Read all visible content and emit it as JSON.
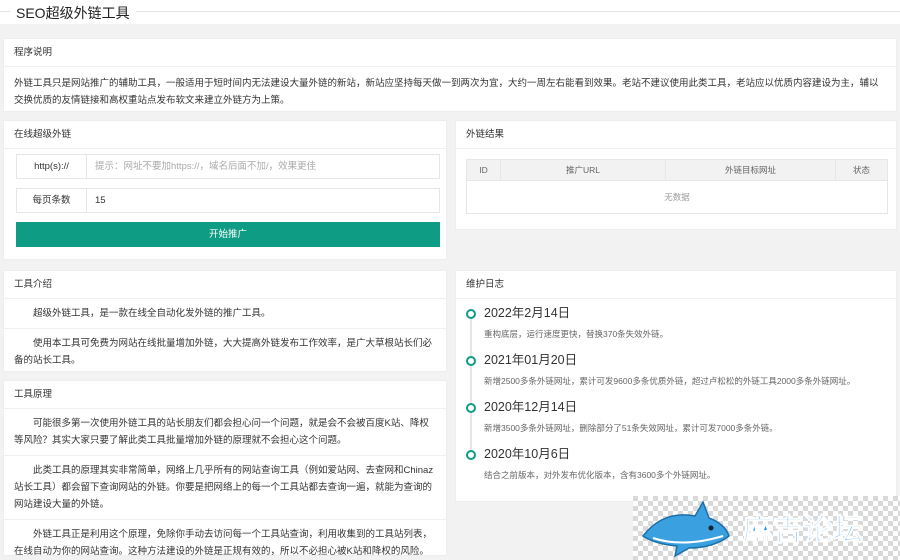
{
  "page": {
    "title": "SEO超级外链工具"
  },
  "intro": {
    "header": "程序说明",
    "text": "外链工具只是网站推广的辅助工具，一般适用于短时间内无法建设大量外链的新站，新站应坚持每天做一到两次为宜，大约一周左右能看到效果。老站不建议使用此类工具，老站应以优质内容建设为主，辅以交换优质的友情链接和高权重站点发布软文来建立外链方为上策。"
  },
  "form": {
    "header": "在线超级外链",
    "url_label": "http(s)://",
    "url_placeholder": "提示：网址不要加https://，域名后面不加/，效果更佳",
    "count_label": "每页条数",
    "count_value": "15",
    "submit_label": "开始推广"
  },
  "results": {
    "header": "外链结果",
    "columns": [
      "ID",
      "推广URL",
      "外链目标网址",
      "状态"
    ],
    "empty_text": "无数据"
  },
  "tool_intro": {
    "header": "工具介绍",
    "paragraphs": [
      "超级外链工具，是一款在线全自动化发外链的推广工具。",
      "使用本工具可免费为网站在线批量增加外链，大大提高外链发布工作效率，是广大草根站长们必备的站长工具。"
    ]
  },
  "principle": {
    "header": "工具原理",
    "paragraphs": [
      "可能很多第一次使用外链工具的站长朋友们都会担心问一个问题，就是会不会被百度K站、降权等风险？其实大家只要了解此类工具批量增加外链的原理就不会担心这个问题。",
      "此类工具的原理其实非常简单，网络上几乎所有的网站查询工具（例如爱站网、去查网和Chinaz站长工具）都会留下查询网站的外链。你要是把网络上的每一个工具站都去查询一遍，就能为查询的网站建设大量的外链。",
      "外链工具正是利用这个原理，免除你手动去访问每一个工具站查询，利用收集到的工具站列表，在线自动为你的网站查询。这种方法建设的外链是正规有效的，所以不必担心被K站和降权的风险。"
    ]
  },
  "changelog": {
    "header": "维护日志",
    "items": [
      {
        "date": "2022年2月14日",
        "desc": "重构底层，运行速度更快，替换370条失效外链。"
      },
      {
        "date": "2021年01月20日",
        "desc": "新增2500多条外链网址，累计可发9600多条优质外链，超过卢松松的外链工具2000多条外链网址。"
      },
      {
        "date": "2020年12月14日",
        "desc": "新增3500多条外链网址，删除部分了51条失效网址，累计可发7000多条外链。"
      },
      {
        "date": "2020年10月6日",
        "desc": "结合之前版本，对外发布优化版本，含有3600多个外链网址。"
      }
    ]
  },
  "watermark": {
    "text": "麻吉论坛"
  },
  "colors": {
    "accent": "#0f9c85",
    "watermark_blue": "#1e90ff"
  }
}
